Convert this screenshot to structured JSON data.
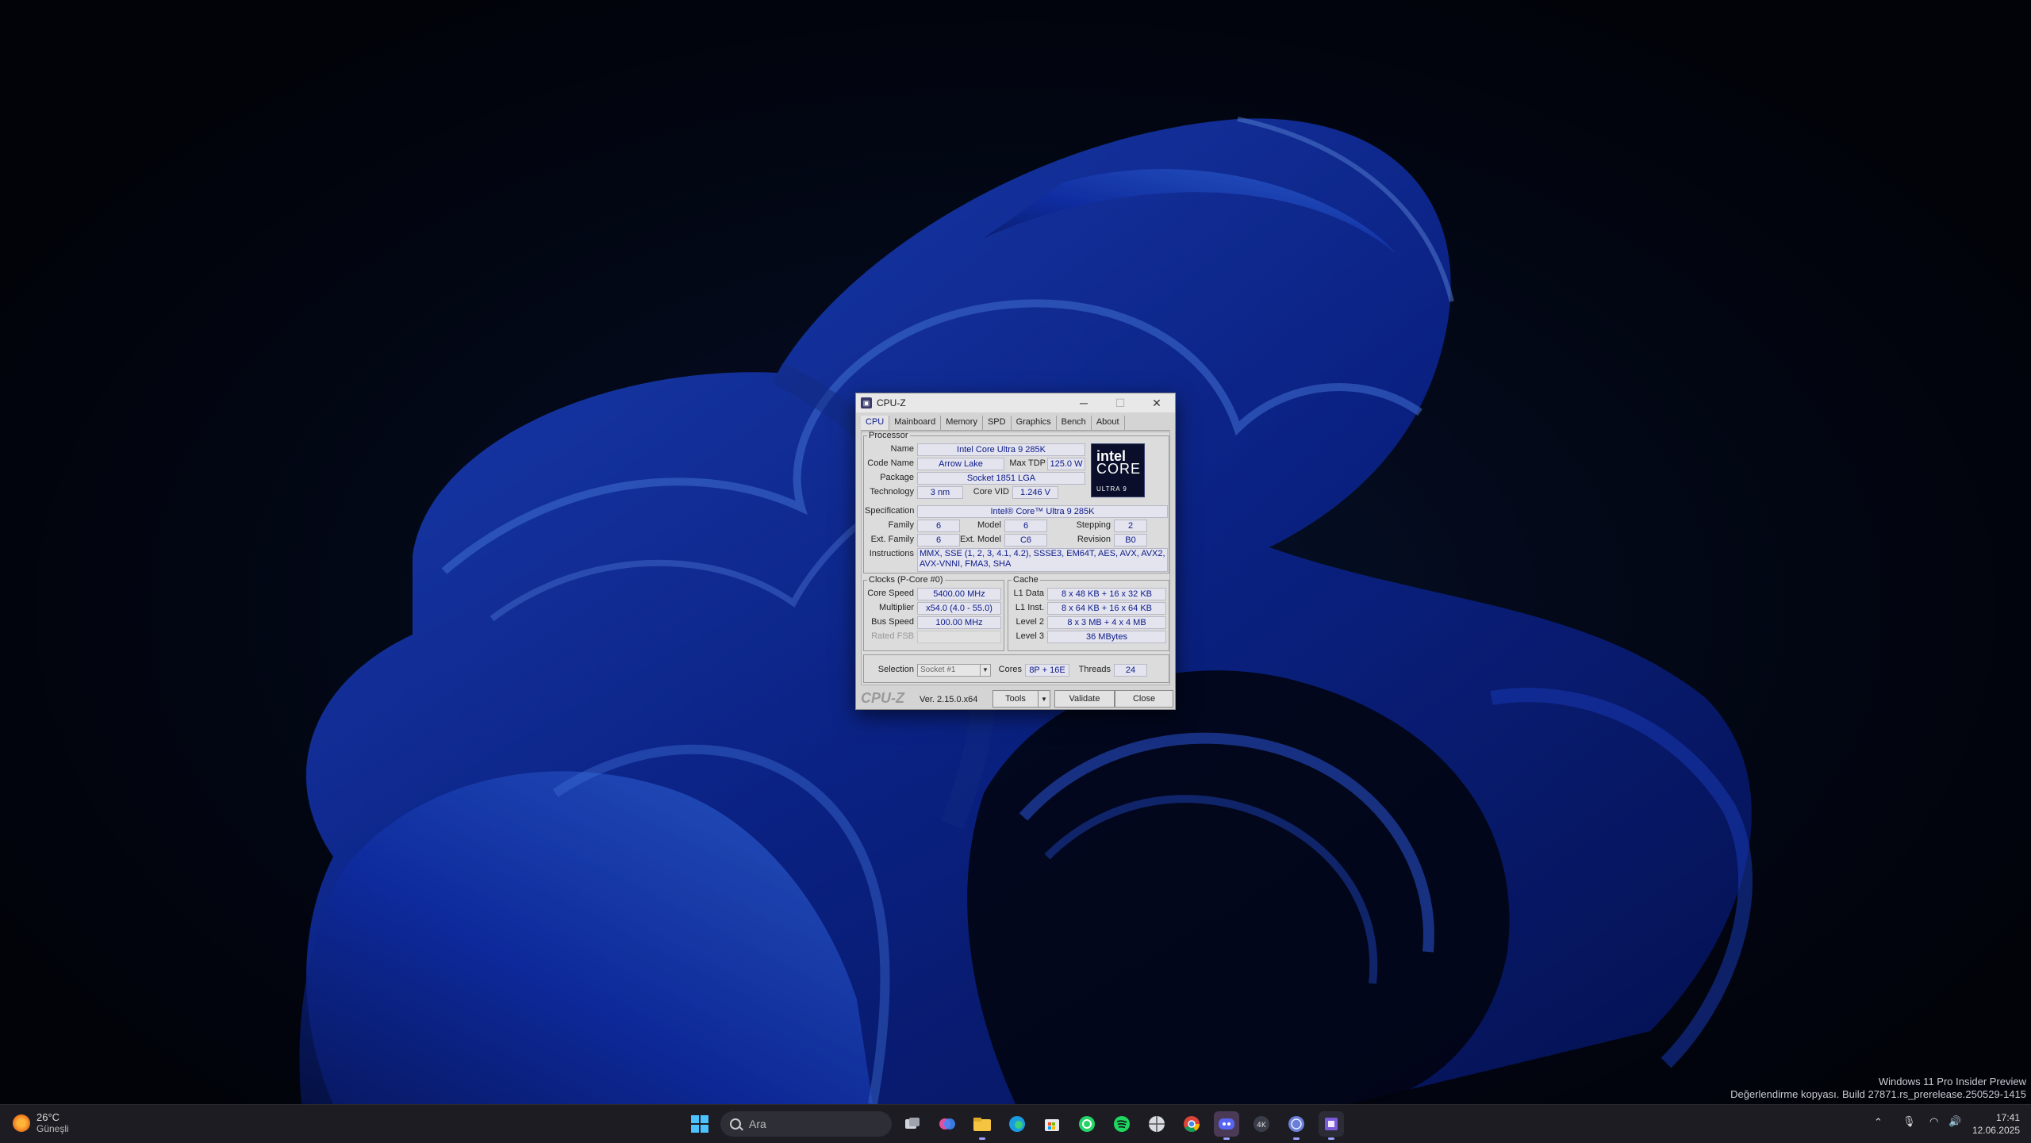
{
  "window": {
    "title": "CPU-Z",
    "minimize": "─",
    "maximize": "☐",
    "close": "✕"
  },
  "tabs": [
    "CPU",
    "Mainboard",
    "Memory",
    "SPD",
    "Graphics",
    "Bench",
    "About"
  ],
  "processor": {
    "legend": "Processor",
    "name_label": "Name",
    "name": "Intel Core Ultra 9 285K",
    "codename_label": "Code Name",
    "codename": "Arrow Lake",
    "maxtdp_label": "Max TDP",
    "maxtdp": "125.0 W",
    "package_label": "Package",
    "package": "Socket 1851 LGA",
    "technology_label": "Technology",
    "technology": "3 nm",
    "corevid_label": "Core VID",
    "corevid": "1.246 V",
    "spec_label": "Specification",
    "spec": "Intel® Core™ Ultra 9 285K",
    "family_label": "Family",
    "family": "6",
    "model_label": "Model",
    "model": "6",
    "stepping_label": "Stepping",
    "stepping": "2",
    "extfamily_label": "Ext. Family",
    "extfamily": "6",
    "extmodel_label": "Ext. Model",
    "extmodel": "C6",
    "revision_label": "Revision",
    "revision": "B0",
    "instructions_label": "Instructions",
    "instructions": "MMX, SSE (1, 2, 3, 4.1, 4.2), SSSE3, EM64T, AES, AVX, AVX2, AVX-VNNI, FMA3, SHA",
    "logo": {
      "line1": "intel",
      "line2": "CORE",
      "line3": "ULTRA  9"
    }
  },
  "clocks": {
    "legend": "Clocks (P-Core #0)",
    "corespeed_label": "Core Speed",
    "corespeed": "5400.00 MHz",
    "multiplier_label": "Multiplier",
    "multiplier": "x54.0 (4.0 - 55.0)",
    "busspeed_label": "Bus Speed",
    "busspeed": "100.00 MHz",
    "ratedfsb_label": "Rated FSB",
    "ratedfsb": ""
  },
  "cache": {
    "legend": "Cache",
    "l1data_label": "L1 Data",
    "l1data": "8 x 48 KB + 16 x 32 KB",
    "l1inst_label": "L1 Inst.",
    "l1inst": "8 x 64 KB + 16 x 64 KB",
    "level2_label": "Level 2",
    "level2": "8 x 3 MB + 4 x 4 MB",
    "level3_label": "Level 3",
    "level3": "36 MBytes"
  },
  "selection": {
    "label": "Selection",
    "value": "Socket #1",
    "cores_label": "Cores",
    "cores": "8P + 16E",
    "threads_label": "Threads",
    "threads": "24"
  },
  "footer": {
    "brand": "CPU-Z",
    "version": "Ver. 2.15.0.x64",
    "tools": "Tools",
    "validate": "Validate",
    "close": "Close"
  },
  "watermark": {
    "line1": "Windows 11 Pro Insider Preview",
    "line2": "Değerlendirme kopyası. Build 27871.rs_prerelease.250529-1415"
  },
  "taskbar": {
    "weather_temp": "26°C",
    "weather_cond": "Güneşli",
    "search_placeholder": "Ara",
    "time": "17:41",
    "date": "12.06.2025",
    "icons": [
      "start-icon",
      "task-view-icon",
      "copilot-icon",
      "file-explorer-icon",
      "edge-icon",
      "store-icon",
      "whatsapp-icon",
      "spotify-icon",
      "network-tool-icon",
      "chrome-icon",
      "discord-icon",
      "4k-video-icon",
      "globe-app-icon",
      "cpuz-icon"
    ]
  }
}
